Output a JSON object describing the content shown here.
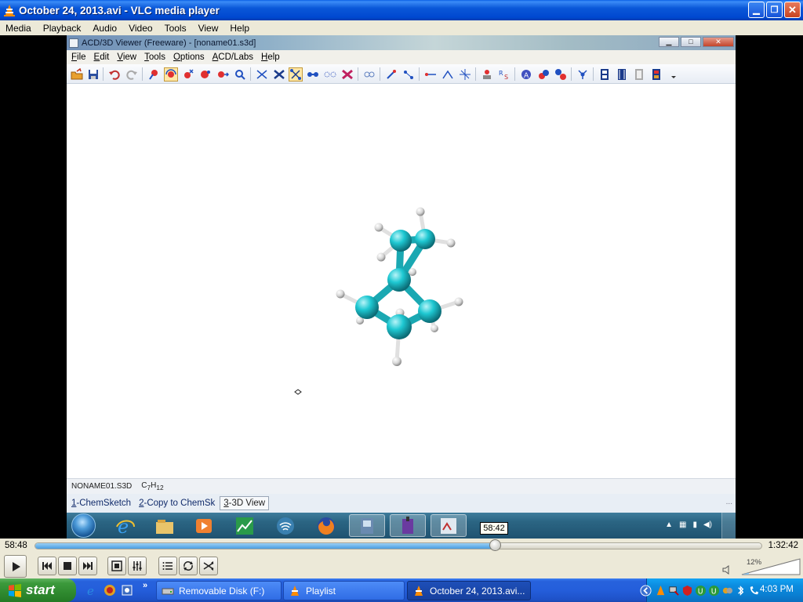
{
  "vlc": {
    "title": "October 24, 2013.avi - VLC media player",
    "menu": [
      "Media",
      "Playback",
      "Audio",
      "Video",
      "Tools",
      "View",
      "Help"
    ],
    "time_elapsed": "58:48",
    "time_total": "1:32:42",
    "seek_tooltip": "58:42",
    "seek_progress": 0.634,
    "volume_percent": "12%",
    "volume_level": 0.12
  },
  "acd": {
    "title": "ACD/3D Viewer (Freeware) - [noname01.s3d]",
    "menu": [
      "File",
      "Edit",
      "View",
      "Tools",
      "Options",
      "ACD/Labs",
      "Help"
    ],
    "status_filename": "NONAME01.S3D",
    "formula": {
      "c": "C",
      "c_n": "7",
      "h": "H",
      "h_n": "12"
    },
    "tabs": [
      {
        "num": "1",
        "label": "-ChemSketch"
      },
      {
        "num": "2",
        "label": "-Copy to ChemSk"
      },
      {
        "num": "3",
        "label": "-3D View"
      }
    ],
    "tabs_more": "..."
  },
  "xp_taskbar": {
    "start_label": "start",
    "tasks": [
      {
        "label": "Removable Disk (F:)"
      },
      {
        "label": "Playlist"
      },
      {
        "label": "October 24, 2013.avi..."
      }
    ],
    "quicklaunch_more": "»",
    "clock": "4:03 PM"
  },
  "colors": {
    "carbon": "#1ec8d2",
    "hydrogen": "#e8e8e8",
    "xp_blue": "#245edb",
    "xp_green": "#2f8a2f"
  }
}
